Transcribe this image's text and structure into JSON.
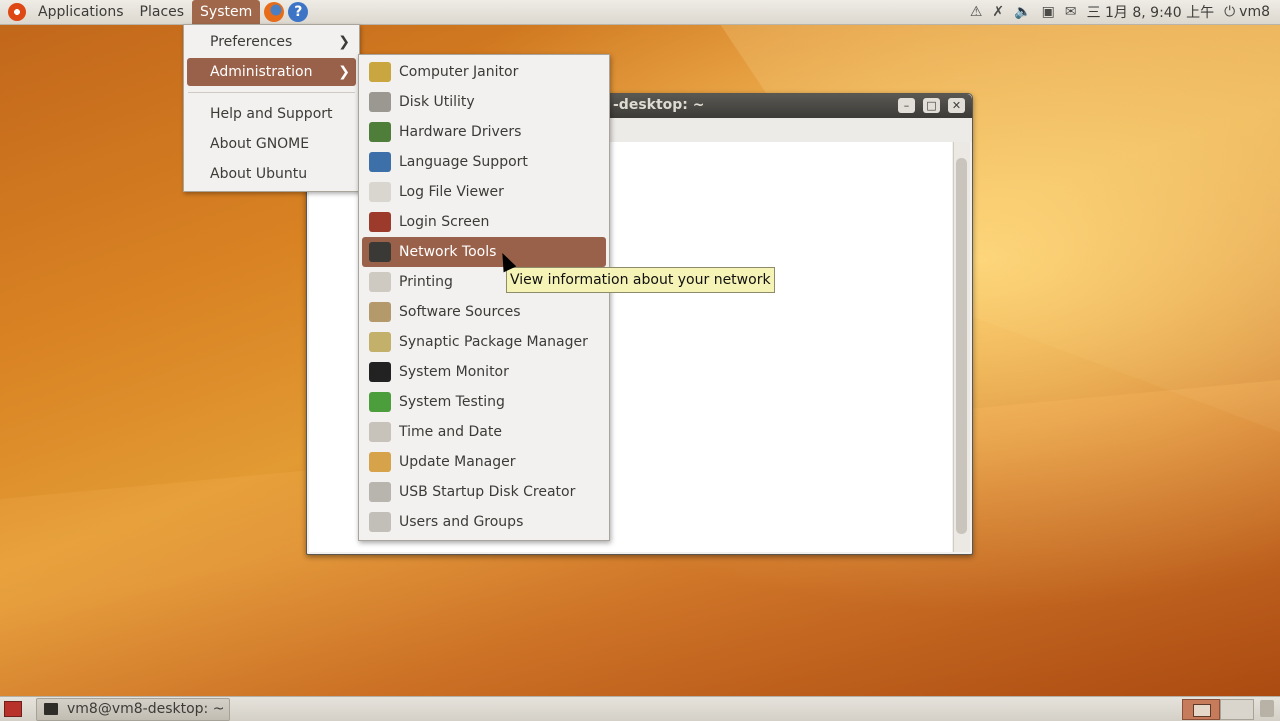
{
  "top_panel": {
    "menus": [
      "Applications",
      "Places",
      "System"
    ],
    "tray": {
      "date_time": "三 1月  8, 9:40 上午",
      "user": "vm8"
    }
  },
  "system_menu": {
    "items": [
      "Preferences",
      "Administration",
      "Help and Support",
      "About GNOME",
      "About Ubuntu"
    ]
  },
  "admin_menu": {
    "items": [
      {
        "label": "Computer Janitor",
        "icon": "broom-icon",
        "color": "#c9a640"
      },
      {
        "label": "Disk Utility",
        "icon": "disk-icon",
        "color": "#9b9891"
      },
      {
        "label": "Hardware Drivers",
        "icon": "chip-icon",
        "color": "#4f7d3a"
      },
      {
        "label": "Language Support",
        "icon": "globe-flag-icon",
        "color": "#3d6fa9"
      },
      {
        "label": "Log File Viewer",
        "icon": "magnifier-log-icon",
        "color": "#d9d6cf"
      },
      {
        "label": "Login Screen",
        "icon": "login-screen-icon",
        "color": "#9c3a2b"
      },
      {
        "label": "Network Tools",
        "icon": "network-tools-icon",
        "color": "#3a3936"
      },
      {
        "label": "Printing",
        "icon": "printer-icon",
        "color": "#cfcac1"
      },
      {
        "label": "Software Sources",
        "icon": "software-sources-icon",
        "color": "#b49a6a"
      },
      {
        "label": "Synaptic Package Manager",
        "icon": "package-icon",
        "color": "#c3b06a"
      },
      {
        "label": "System Monitor",
        "icon": "system-monitor-icon",
        "color": "#222222"
      },
      {
        "label": "System Testing",
        "icon": "checkmark-icon",
        "color": "#4c9e3d"
      },
      {
        "label": "Time and Date",
        "icon": "clock-calendar-icon",
        "color": "#c7c3bb"
      },
      {
        "label": "Update Manager",
        "icon": "update-icon",
        "color": "#d6a24a"
      },
      {
        "label": "USB Startup Disk Creator",
        "icon": "usb-icon",
        "color": "#b8b5ae"
      },
      {
        "label": "Users and Groups",
        "icon": "users-icon",
        "color": "#c2bfb8"
      }
    ],
    "highlighted": "Network Tools"
  },
  "tooltip": "View information about your network",
  "terminal_window": {
    "title": "-desktop: ~"
  },
  "bottom_panel": {
    "task": "vm8@vm8-desktop: ~"
  },
  "colors": {
    "highlight": "#9a614a",
    "tooltip_bg": "#f5f3b5"
  }
}
